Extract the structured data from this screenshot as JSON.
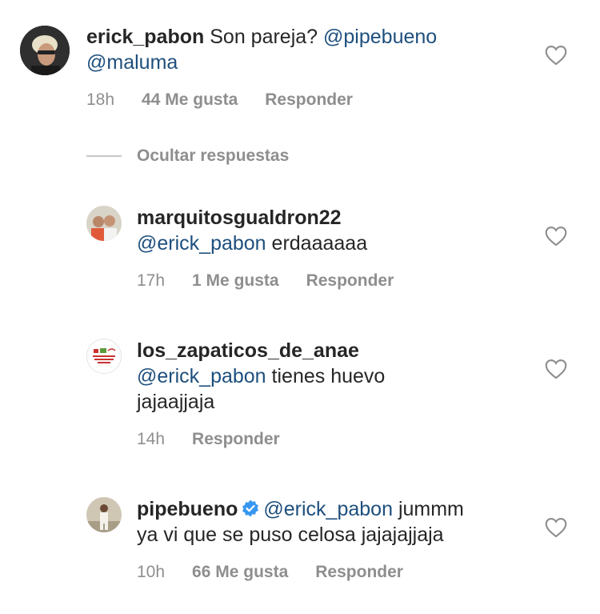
{
  "comments": [
    {
      "username": "erick_pabon",
      "text": "Son pareja?",
      "mentions": [
        "@pipebueno",
        "@maluma"
      ],
      "time": "18h",
      "likes": "44 Me gusta",
      "reply": "Responder"
    },
    {
      "username": "marquitosgualdron22",
      "mention": "@erick_pabon",
      "text": "erdaaaaaa",
      "time": "17h",
      "likes": "1 Me gusta",
      "reply": "Responder"
    },
    {
      "username": "los_zapaticos_de_anae",
      "mention": "@erick_pabon",
      "text_line1": "tienes huevo",
      "text_line2": "jajaajjaja",
      "time": "14h",
      "reply": "Responder",
      "avatar_text": "LOS ZAPATICOS DE ANAE"
    },
    {
      "username": "pipebueno",
      "mention": "@erick_pabon",
      "text_line1": "jummm",
      "text_line2": "ya vi que se puso celosa jajajajjaja",
      "time": "10h",
      "likes": "66 Me gusta",
      "reply": "Responder"
    }
  ],
  "hide_replies": "Ocultar respuestas",
  "colors": {
    "mention": "#1e4f7d",
    "meta": "#8e8e8e",
    "verified": "#3897f0"
  },
  "icons": {
    "like": "heart-outline-icon",
    "verified": "verified-badge-icon"
  }
}
